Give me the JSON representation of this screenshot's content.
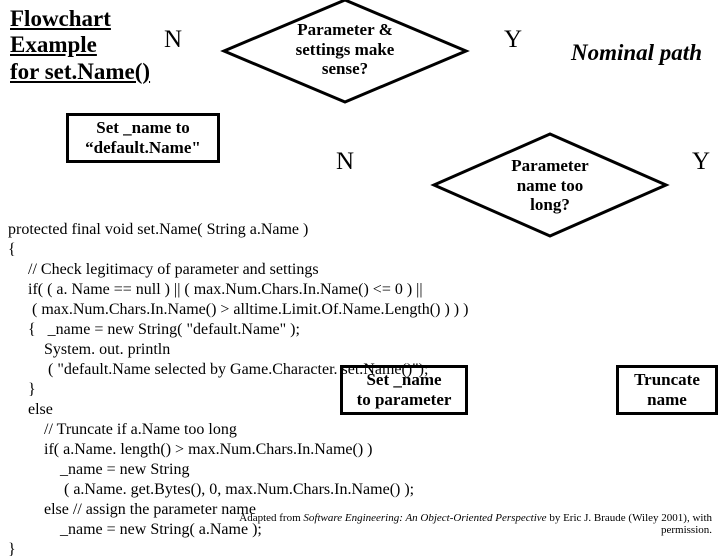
{
  "title": "Flowchart\nExample\nfor set.Name()",
  "nominal": "Nominal path",
  "diamond1": {
    "text": "Parameter &\nsettings make\nsense?",
    "n": "N",
    "y": "Y"
  },
  "diamond2": {
    "text": "Parameter\nname too\nlong?",
    "n": "N",
    "y": "Y"
  },
  "box_default": "Set _name to\n“default.Name\"",
  "box_setparam": "Set _name\nto parameter",
  "box_truncate": "Truncate\nname",
  "code": "protected final void set.Name( String a.Name )\n{\n     // Check legitimacy of parameter and settings\n     if( ( a. Name == null ) || ( max.Num.Chars.In.Name() <= 0 ) ||\n      ( max.Num.Chars.In.Name() > alltime.Limit.Of.Name.Length() ) ) )\n     {   _name = new String( \"default.Name\" );\n         System. out. println\n          ( \"default.Name selected by Game.Character. set.Name()\");\n     }\n     else\n         // Truncate if a.Name too long\n         if( a.Name. length() > max.Num.Chars.In.Name() )\n             _name = new String\n              ( a.Name. get.Bytes(), 0, max.Num.Chars.In.Name() );\n         else // assign the parameter name\n             _name = new String( a.Name );\n}",
  "credit_pre": "Adapted from ",
  "credit_title": "Software Engineering: An Object-Oriented Perspective",
  "credit_post": " by Eric J. Braude (Wiley 2001), with permission."
}
